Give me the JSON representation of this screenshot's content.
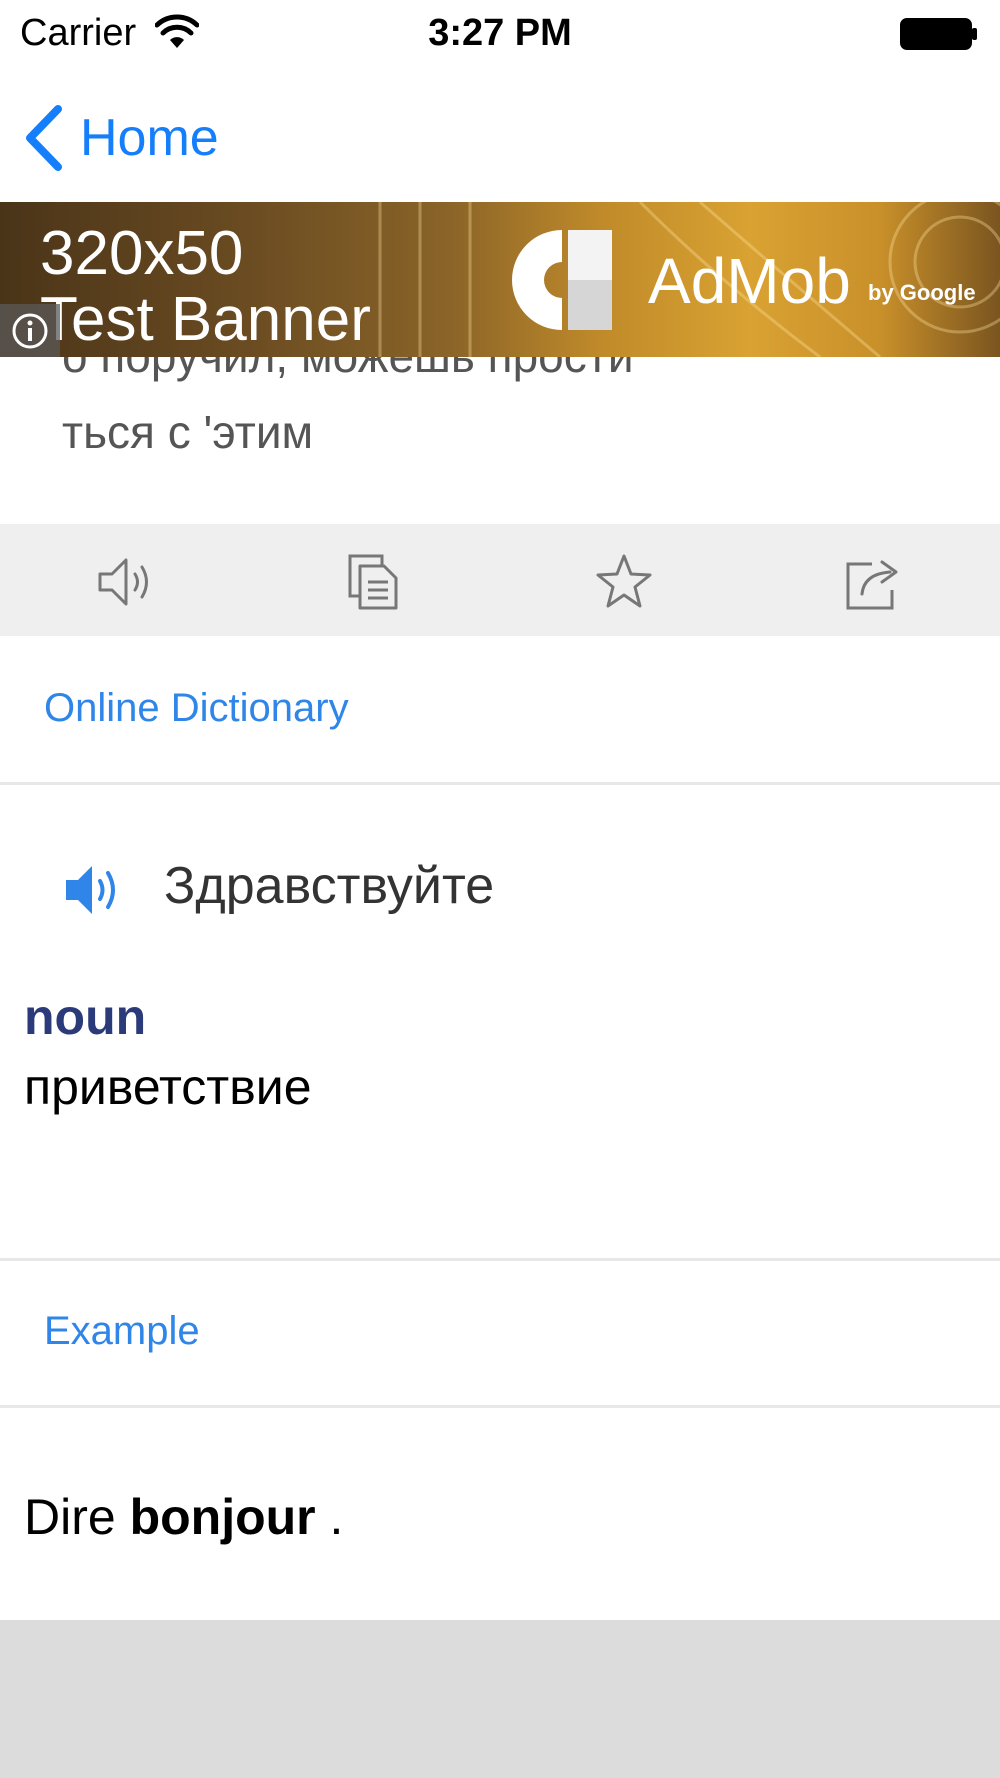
{
  "status_bar": {
    "carrier": "Carrier",
    "time": "3:27 PM"
  },
  "nav": {
    "back_label": "Home"
  },
  "translation": {
    "line1": "о поручил, можешь прости",
    "line2": "ться с 'этим"
  },
  "ad": {
    "line1": "320x50",
    "line2": "Test Banner",
    "brand": "AdMob",
    "by": "by Google"
  },
  "actions": {
    "icons": [
      "speaker-icon",
      "copy-icon",
      "star-icon",
      "share-icon"
    ]
  },
  "online_dictionary": {
    "title": "Online Dictionary",
    "word": "Здравствуйте",
    "part_of_speech": "noun",
    "meaning": "приветствие"
  },
  "example": {
    "title": "Example",
    "prefix": "Dire ",
    "highlight": "bonjour",
    "suffix": " ."
  },
  "colors": {
    "accent": "#147efb",
    "section_title": "#2f86e8",
    "pos": "#2b3b7a",
    "toolbar_bg": "#efefef",
    "footer_bg": "#dcdcdc"
  }
}
